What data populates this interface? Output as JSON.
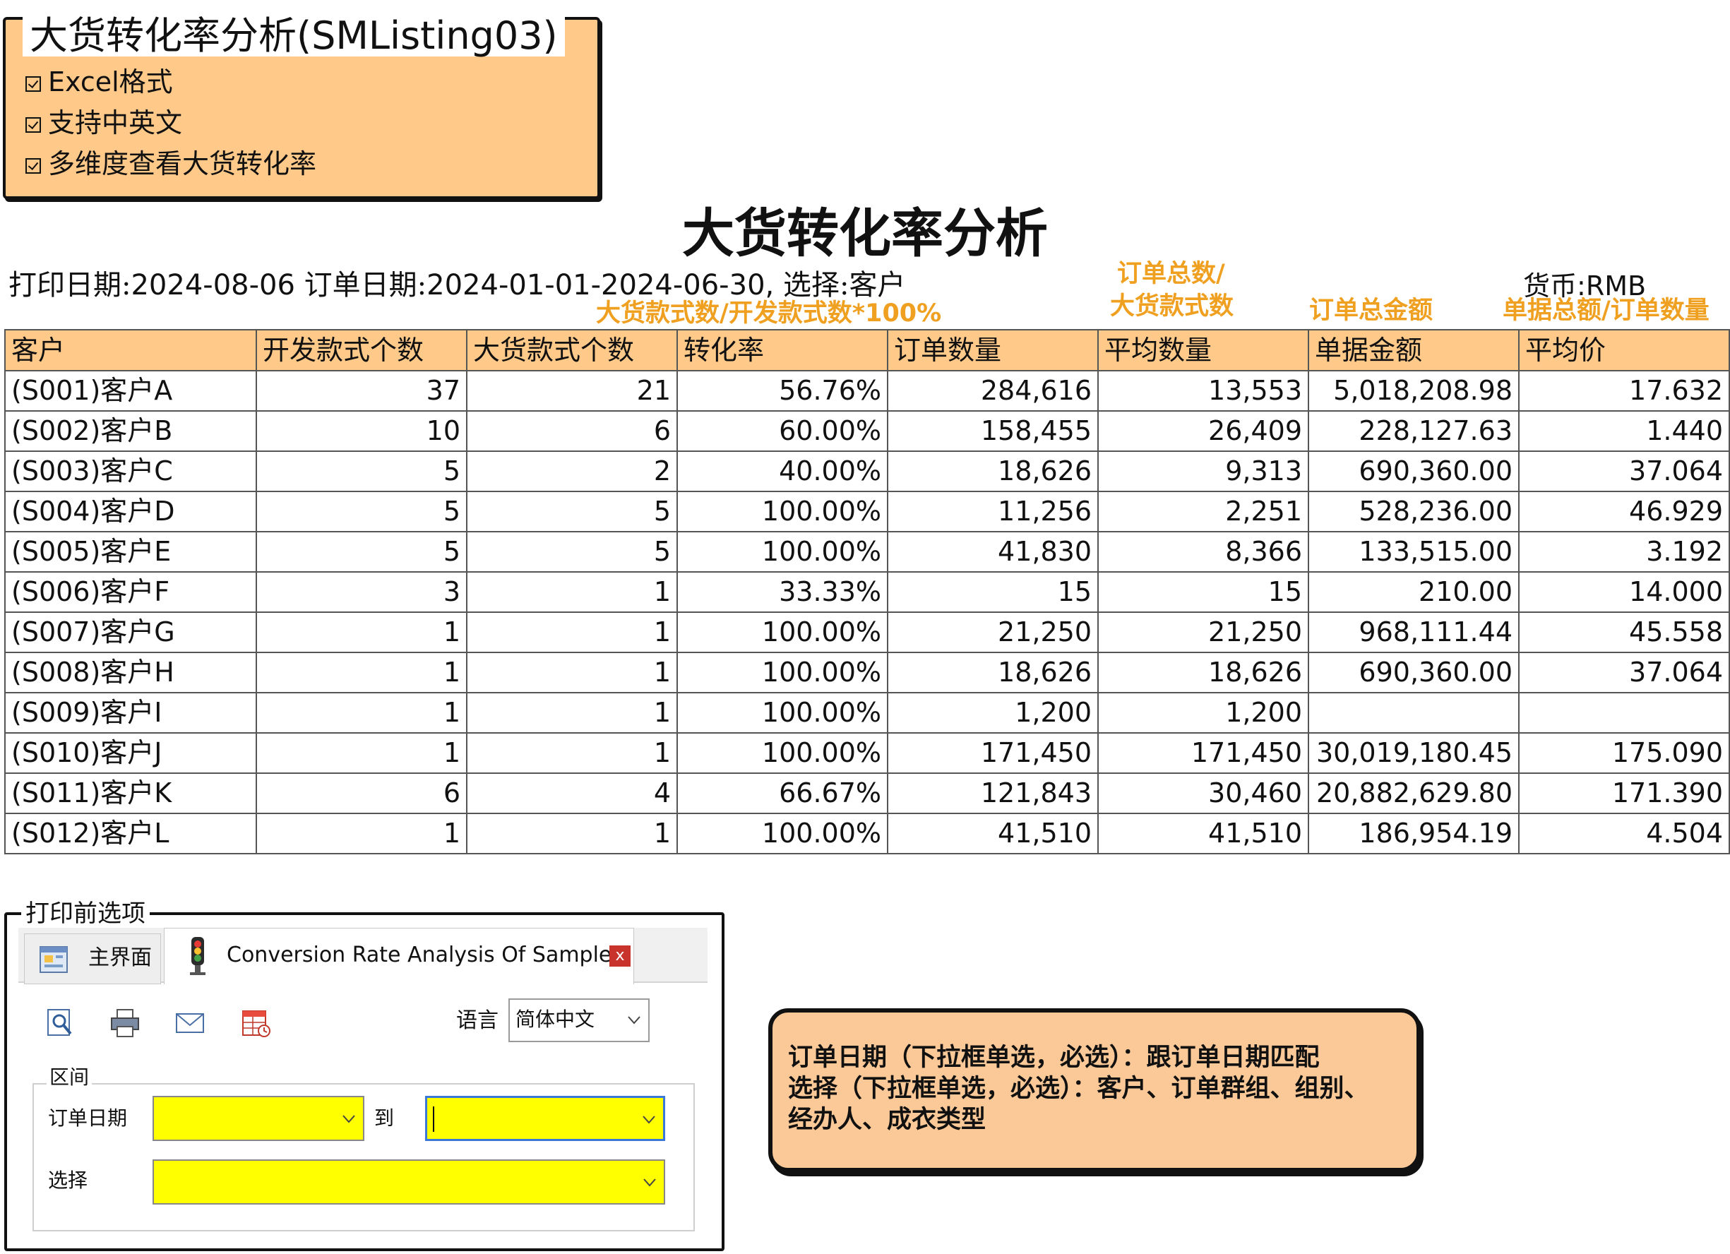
{
  "feature_box": {
    "title": "大货转化率分析(SMListing03)",
    "items": [
      "Excel格式",
      "支持中英文",
      "多维度查看大货转化率"
    ]
  },
  "report": {
    "title": "大货转化率分析",
    "print_date_label": "打印日期:",
    "print_date": "2024-08-06",
    "order_date_label": "订单日期:",
    "order_date_range": "2024-01-01-2024-06-30,",
    "select_label": "选择:",
    "select_value": "客户",
    "currency_label": "货币:",
    "currency_value": "RMB"
  },
  "notes": {
    "conversion_formula": "大货款式数/开发款式数*100%",
    "avg_qty_formula_line1": "订单总数/",
    "avg_qty_formula_line2": "大货款式数",
    "amount_note": "订单总金额",
    "avg_price_formula": "单据总额/订单数量"
  },
  "table": {
    "columns": [
      "客户",
      "开发款式个数",
      "大货款式个数",
      "转化率",
      "订单数量",
      "平均数量",
      "单据金额",
      "平均价"
    ],
    "rows": [
      [
        "(S001)客户A",
        "37",
        "21",
        "56.76%",
        "284,616",
        "13,553",
        "5,018,208.98",
        "17.632"
      ],
      [
        "(S002)客户B",
        "10",
        "6",
        "60.00%",
        "158,455",
        "26,409",
        "228,127.63",
        "1.440"
      ],
      [
        "(S003)客户C",
        "5",
        "2",
        "40.00%",
        "18,626",
        "9,313",
        "690,360.00",
        "37.064"
      ],
      [
        "(S004)客户D",
        "5",
        "5",
        "100.00%",
        "11,256",
        "2,251",
        "528,236.00",
        "46.929"
      ],
      [
        "(S005)客户E",
        "5",
        "5",
        "100.00%",
        "41,830",
        "8,366",
        "133,515.00",
        "3.192"
      ],
      [
        "(S006)客户F",
        "3",
        "1",
        "33.33%",
        "15",
        "15",
        "210.00",
        "14.000"
      ],
      [
        "(S007)客户G",
        "1",
        "1",
        "100.00%",
        "21,250",
        "21,250",
        "968,111.44",
        "45.558"
      ],
      [
        "(S008)客户H",
        "1",
        "1",
        "100.00%",
        "18,626",
        "18,626",
        "690,360.00",
        "37.064"
      ],
      [
        "(S009)客户I",
        "1",
        "1",
        "100.00%",
        "1,200",
        "1,200",
        "",
        ""
      ],
      [
        "(S010)客户J",
        "1",
        "1",
        "100.00%",
        "171,450",
        "171,450",
        "30,019,180.45",
        "175.090"
      ],
      [
        "(S011)客户K",
        "6",
        "4",
        "66.67%",
        "121,843",
        "30,460",
        "20,882,629.80",
        "171.390"
      ],
      [
        "(S012)客户L",
        "1",
        "1",
        "100.00%",
        "41,510",
        "41,510",
        "186,954.19",
        "4.504"
      ]
    ]
  },
  "print_panel": {
    "title": "打印前选项",
    "tab_main": "主界面",
    "tab_active": "Conversion Rate Analysis Of Sample",
    "tab_close": "x",
    "toolbar_icons": [
      "preview-icon",
      "print-icon",
      "email-icon",
      "export-excel-icon"
    ],
    "language_label": "语言",
    "language_value": "简体中文",
    "range_label": "区间",
    "order_date_label": "订单日期",
    "to_label": "到",
    "select_label": "选择",
    "field_color": "#ffff00"
  },
  "note_box": {
    "lines": [
      "订单日期（下拉框单选，必选）：跟订单日期匹配",
      "选择（下拉框单选，必选）：客户、订单群组、组别、",
      "经办人、成衣类型"
    ]
  },
  "colors": {
    "header_fill": "#ffc98a",
    "note_text": "#f0a020",
    "note_box_fill": "#fbc998",
    "close_button": "#c8332c"
  }
}
